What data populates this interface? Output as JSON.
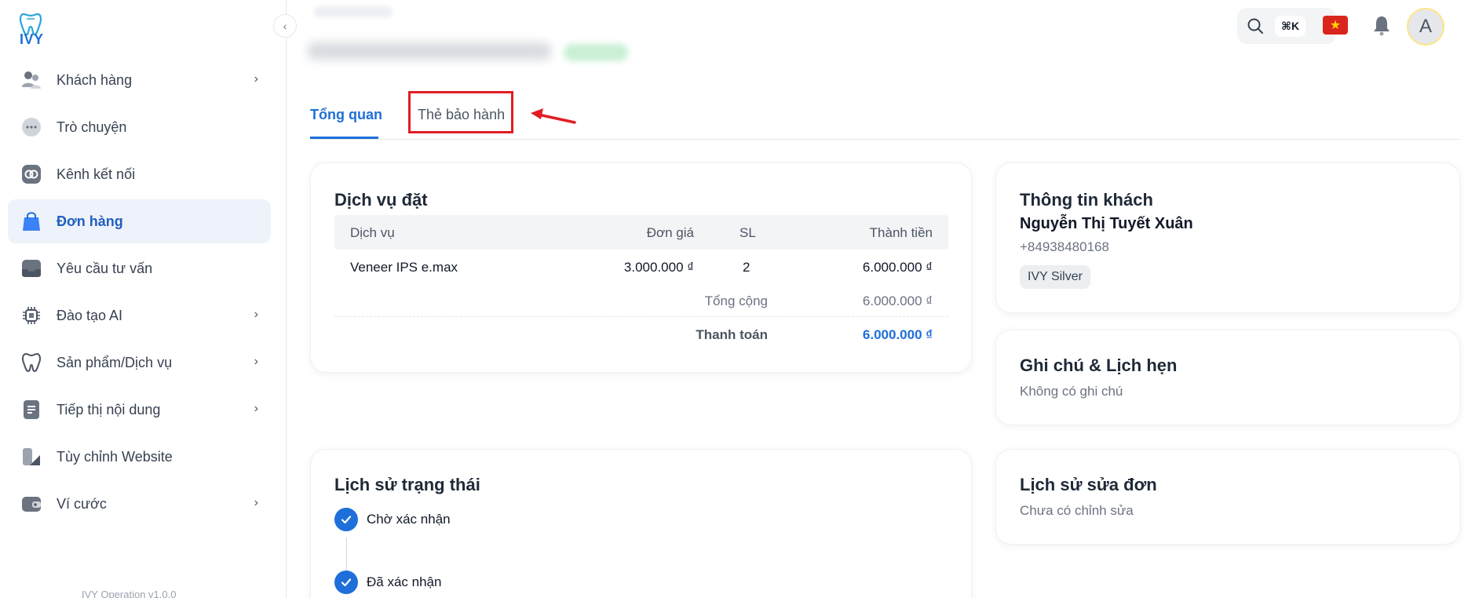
{
  "app": {
    "logo_text": "IVY",
    "version": "IVY Operation v1.0.0"
  },
  "sidebar": {
    "items": [
      {
        "label": "Khách hàng",
        "icon": "users-icon",
        "chevron": true,
        "active": false
      },
      {
        "label": "Trò chuyện",
        "icon": "chat-icon",
        "chevron": false,
        "active": false
      },
      {
        "label": "Kênh kết nối",
        "icon": "link-icon",
        "chevron": false,
        "active": false
      },
      {
        "label": "Đơn hàng",
        "icon": "shopping-bag-icon",
        "chevron": false,
        "active": true
      },
      {
        "label": "Yêu cầu tư vấn",
        "icon": "inbox-icon",
        "chevron": false,
        "active": false
      },
      {
        "label": "Đào tạo AI",
        "icon": "chip-icon",
        "chevron": true,
        "active": false
      },
      {
        "label": "Sản phẩm/Dịch vụ",
        "icon": "tooth-icon",
        "chevron": true,
        "active": false
      },
      {
        "label": "Tiếp thị nội dung",
        "icon": "document-icon",
        "chevron": true,
        "active": false
      },
      {
        "label": "Tùy chỉnh Website",
        "icon": "website-icon",
        "chevron": false,
        "active": false
      },
      {
        "label": "Ví cước",
        "icon": "wallet-icon",
        "chevron": true,
        "active": false
      }
    ]
  },
  "topbar": {
    "search_shortcut": "⌘K",
    "avatar_initial": "A"
  },
  "tabs": [
    {
      "label": "Tổng quan",
      "active": true
    },
    {
      "label": "Thẻ bảo hành",
      "active": false
    }
  ],
  "services": {
    "title": "Dịch vụ đặt",
    "columns": [
      "Dịch vụ",
      "Đơn giá",
      "SL",
      "Thành tiền"
    ],
    "rows": [
      {
        "service": "Veneer IPS e.max",
        "unit_price": "3.000.000 ₫",
        "qty": "2",
        "amount": "6.000.000 ₫"
      }
    ],
    "total_label": "Tổng cộng",
    "total_value": "6.000.000 ₫",
    "payment_label": "Thanh toán",
    "payment_value": "6.000.000 ₫"
  },
  "customer": {
    "title": "Thông tin khách",
    "name": "Nguyễn Thị Tuyết Xuân",
    "phone": "+84938480168",
    "tier": "IVY Silver"
  },
  "notes": {
    "title": "Ghi chú & Lịch hẹn",
    "empty": "Không có ghi chú"
  },
  "edit_history": {
    "title": "Lịch sử sửa đơn",
    "empty": "Chưa có chỉnh sửa"
  },
  "status_history": {
    "title": "Lịch sử trạng thái",
    "items": [
      "Chờ xác nhận",
      "Đã xác nhận"
    ]
  },
  "colors": {
    "accent": "#1e6fd9",
    "highlight": "#e11d24",
    "active_bg": "#eef3fb"
  }
}
